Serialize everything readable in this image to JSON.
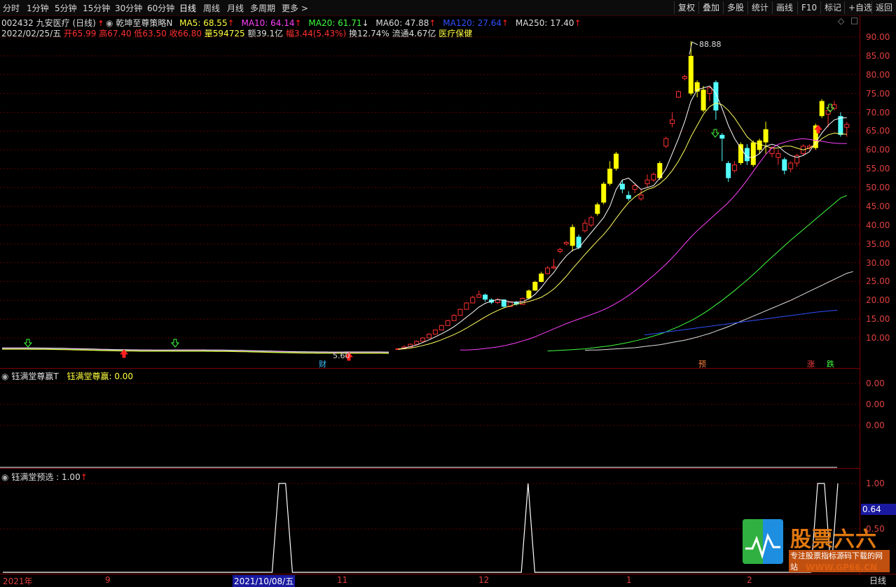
{
  "toolbar": {
    "periods": [
      "分时",
      "1分钟",
      "5分钟",
      "15分钟",
      "30分钟",
      "60分钟",
      "日线",
      "周线",
      "月线",
      "多周期",
      "更多 >"
    ],
    "active_period": "日线",
    "right_buttons": [
      "复权",
      "叠加",
      "多股",
      "统计",
      "画线",
      "F10",
      "标记",
      "+自选",
      "返回"
    ]
  },
  "stock": {
    "code_name": "002432 九安医疗 (日线)",
    "indicator_name": "乾坤至尊策略N",
    "ma5": "MA5: 68.55",
    "ma10": "MA10: 64.14",
    "ma20": "MA20: 61.71",
    "ma60": "MA60: 47.88",
    "ma120": "MA120: 27.64",
    "ma250": "MA250: 17.40",
    "date": "2022/02/25/五",
    "open": "开65.99",
    "high": "高67.40",
    "low": "低63.50",
    "close": "收66.80",
    "volume": "量594725",
    "amount": "额39.1亿",
    "change": "幅3.44(5.43%)",
    "turnover": "换12.74%",
    "float_cap": "流通4.67亿",
    "sector": "医疗保健",
    "colors": {
      "ma5": "#ffffff",
      "ma10": "#ff40ff",
      "ma20": "#00ff00",
      "ma60": "#ffffff",
      "ma120": "#4060ff",
      "ma250": "#ffffff"
    }
  },
  "main_axis": [
    "90.00",
    "85.00",
    "80.00",
    "75.00",
    "70.00",
    "65.00",
    "60.00",
    "55.00",
    "50.00",
    "45.00",
    "40.00",
    "35.00",
    "30.00",
    "25.00",
    "20.00",
    "15.00",
    "10.00"
  ],
  "annotations": {
    "peak": "88.88",
    "low": "5.60",
    "cai": "财",
    "yu": "预",
    "zhang": "涨",
    "die": "跌"
  },
  "panel2": {
    "title": "钰满堂尊赢T",
    "value_label": "钰满堂尊赢: 0.00",
    "axis": [
      "0.00",
      "0.00",
      "0.00"
    ]
  },
  "panel3": {
    "title": "钰满堂预选 : 1.00",
    "axis": [
      "1.00",
      "0.50"
    ],
    "cursor_value": "0.64"
  },
  "xaxis": {
    "labels": [
      "2021年",
      "9",
      "2021/10/08/五",
      "11",
      "12",
      "1",
      "2"
    ],
    "period": "日线"
  },
  "watermark": {
    "brand": "股票六六",
    "slogan": "专注股票指标源码下载的网站",
    "url": "WWW.GP66.CN"
  },
  "chart_data": {
    "type": "candlestick",
    "ylim": [
      5,
      92
    ],
    "candles": [
      {
        "o": 7.0,
        "c": 7.1,
        "h": 7.2,
        "l": 6.9
      },
      {
        "o": 7.2,
        "c": 7.6,
        "h": 8.0,
        "l": 7.1
      },
      {
        "o": 7.6,
        "c": 8.3,
        "h": 8.5,
        "l": 7.5
      },
      {
        "o": 8.3,
        "c": 9.1,
        "h": 9.3,
        "l": 8.2
      },
      {
        "o": 9.1,
        "c": 10.0,
        "h": 10.2,
        "l": 9.0
      },
      {
        "o": 10.0,
        "c": 11.0,
        "h": 11.2,
        "l": 9.9
      },
      {
        "o": 11.0,
        "c": 12.1,
        "h": 12.3,
        "l": 10.9
      },
      {
        "o": 12.1,
        "c": 13.3,
        "h": 13.5,
        "l": 12.0
      },
      {
        "o": 13.3,
        "c": 14.6,
        "h": 14.8,
        "l": 13.2
      },
      {
        "o": 14.6,
        "c": 16.0,
        "h": 16.3,
        "l": 14.5
      },
      {
        "o": 16.0,
        "c": 17.6,
        "h": 17.8,
        "l": 15.9
      },
      {
        "o": 17.6,
        "c": 19.3,
        "h": 19.5,
        "l": 17.5
      },
      {
        "o": 19.3,
        "c": 20.8,
        "h": 21.2,
        "l": 19.2
      },
      {
        "o": 20.8,
        "c": 21.5,
        "h": 22.6,
        "l": 20.6
      },
      {
        "o": 21.5,
        "c": 20.2,
        "h": 21.8,
        "l": 19.6
      },
      {
        "o": 20.2,
        "c": 19.4,
        "h": 20.5,
        "l": 19.0
      },
      {
        "o": 19.4,
        "c": 20.2,
        "h": 20.6,
        "l": 19.0
      },
      {
        "o": 20.2,
        "c": 18.3,
        "h": 20.3,
        "l": 18.1
      },
      {
        "o": 18.3,
        "c": 19.6,
        "h": 19.8,
        "l": 18.2
      },
      {
        "o": 19.6,
        "c": 18.9,
        "h": 19.8,
        "l": 18.6
      },
      {
        "o": 18.9,
        "c": 20.5,
        "h": 20.8,
        "l": 18.8
      },
      {
        "o": 20.5,
        "c": 22.6,
        "h": 22.9,
        "l": 20.4
      },
      {
        "o": 22.6,
        "c": 24.9,
        "h": 25.2,
        "l": 22.5
      },
      {
        "o": 24.9,
        "c": 27.1,
        "h": 27.6,
        "l": 24.8
      },
      {
        "o": 27.1,
        "c": 28.6,
        "h": 29.1,
        "l": 26.9
      },
      {
        "o": 28.6,
        "c": 28.9,
        "h": 31.0,
        "l": 28.3
      },
      {
        "o": 33.0,
        "c": 33.5,
        "h": 34.0,
        "l": 32.5
      },
      {
        "o": 35.0,
        "c": 35.4,
        "h": 35.8,
        "l": 34.6
      },
      {
        "o": 34.5,
        "c": 39.5,
        "h": 40.2,
        "l": 33.0
      },
      {
        "o": 36.9,
        "c": 34.0,
        "h": 37.5,
        "l": 33.6
      },
      {
        "o": 38.5,
        "c": 40.5,
        "h": 41.5,
        "l": 38.0
      },
      {
        "o": 40.0,
        "c": 42.0,
        "h": 42.5,
        "l": 39.5
      },
      {
        "o": 43.0,
        "c": 45.5,
        "h": 46.0,
        "l": 42.5
      },
      {
        "o": 46.0,
        "c": 51.0,
        "h": 51.5,
        "l": 45.5
      },
      {
        "o": 51.0,
        "c": 55.0,
        "h": 57.0,
        "l": 50.5
      },
      {
        "o": 55.0,
        "c": 59.0,
        "h": 59.5,
        "l": 54.5
      },
      {
        "o": 51.0,
        "c": 49.5,
        "h": 52.0,
        "l": 48.5
      },
      {
        "o": 48.0,
        "c": 47.0,
        "h": 49.0,
        "l": 46.5
      },
      {
        "o": 49.5,
        "c": 50.5,
        "h": 51.0,
        "l": 48.5
      },
      {
        "o": 47.0,
        "c": 48.0,
        "h": 49.5,
        "l": 46.5
      },
      {
        "o": 51.0,
        "c": 52.0,
        "h": 53.5,
        "l": 50.0
      },
      {
        "o": 52.0,
        "c": 53.5,
        "h": 54.0,
        "l": 51.5
      },
      {
        "o": 52.5,
        "c": 56.5,
        "h": 57.0,
        "l": 52.0
      },
      {
        "o": 61.0,
        "c": 63.0,
        "h": 63.5,
        "l": 60.5
      },
      {
        "o": 67.0,
        "c": 68.0,
        "h": 70.0,
        "l": 66.0
      },
      {
        "o": 74.0,
        "c": 75.5,
        "h": 75.8,
        "l": 73.8
      },
      {
        "o": 79.0,
        "c": 79.5,
        "h": 80.0,
        "l": 78.5
      },
      {
        "o": 75.0,
        "c": 85.0,
        "h": 88.88,
        "l": 74.5
      },
      {
        "o": 75.5,
        "c": 78.0,
        "h": 78.5,
        "l": 74.0
      },
      {
        "o": 70.5,
        "c": 76.0,
        "h": 77.0,
        "l": 70.0
      },
      {
        "o": 75.0,
        "c": 76.5,
        "h": 77.0,
        "l": 73.0
      },
      {
        "o": 78.0,
        "c": 70.5,
        "h": 78.5,
        "l": 68.0
      },
      {
        "o": 64.0,
        "c": 63.0,
        "h": 64.5,
        "l": 57.0
      },
      {
        "o": 56.5,
        "c": 52.5,
        "h": 57.0,
        "l": 51.5
      },
      {
        "o": 54.5,
        "c": 56.0,
        "h": 57.0,
        "l": 54.0
      },
      {
        "o": 56.5,
        "c": 61.5,
        "h": 62.0,
        "l": 56.0
      },
      {
        "o": 60.5,
        "c": 57.0,
        "h": 61.5,
        "l": 56.0
      },
      {
        "o": 56.0,
        "c": 62.0,
        "h": 62.5,
        "l": 55.5
      },
      {
        "o": 60.0,
        "c": 62.5,
        "h": 63.0,
        "l": 59.0
      },
      {
        "o": 62.0,
        "c": 65.5,
        "h": 67.5,
        "l": 59.0
      },
      {
        "o": 59.0,
        "c": 60.5,
        "h": 61.0,
        "l": 58.0
      },
      {
        "o": 58.0,
        "c": 59.0,
        "h": 60.0,
        "l": 56.0
      },
      {
        "o": 57.5,
        "c": 54.5,
        "h": 58.0,
        "l": 53.5
      },
      {
        "o": 55.0,
        "c": 56.5,
        "h": 57.0,
        "l": 54.0
      },
      {
        "o": 56.5,
        "c": 58.5,
        "h": 59.0,
        "l": 55.5
      },
      {
        "o": 59.0,
        "c": 61.0,
        "h": 61.5,
        "l": 58.5
      },
      {
        "o": 60.5,
        "c": 61.0,
        "h": 61.5,
        "l": 60.0
      },
      {
        "o": 60.5,
        "c": 66.5,
        "h": 67.0,
        "l": 60.0
      },
      {
        "o": 69.0,
        "c": 73.0,
        "h": 73.5,
        "l": 68.5
      },
      {
        "o": 69.5,
        "c": 70.5,
        "h": 72.0,
        "l": 66.0
      },
      {
        "o": 71.0,
        "c": 72.0,
        "h": 73.0,
        "l": 70.5
      },
      {
        "o": 69.0,
        "c": 64.0,
        "h": 70.0,
        "l": 63.5
      },
      {
        "o": 65.99,
        "c": 66.8,
        "h": 67.4,
        "l": 63.5
      }
    ],
    "ma5": [
      7.0,
      7.3,
      7.7,
      8.1,
      8.8,
      9.5,
      10.3,
      11.1,
      12.0,
      13.0,
      14.2,
      15.5,
      16.8,
      18.2,
      19.2,
      19.8,
      20.2,
      20.0,
      19.5,
      19.5,
      19.6,
      20.4,
      21.6,
      23.4,
      25.6,
      27.4,
      29.8,
      31.8,
      33.3,
      33.9,
      36.0,
      38.0,
      40.0,
      42.0,
      45.0,
      49.5,
      52.0,
      52.5,
      51.0,
      49.5,
      50.0,
      50.5,
      52.5,
      55.0,
      59.0,
      63.0,
      67.5,
      73.0,
      76.0,
      76.5,
      77.0,
      75.0,
      71.0,
      66.5,
      63.0,
      60.5,
      58.0,
      58.0,
      59.0,
      61.0,
      61.5,
      61.0,
      59.5,
      58.5,
      58.0,
      58.5,
      59.5,
      62.0,
      64.5,
      66.5,
      68.0,
      68.5,
      68.55
    ],
    "ma10": [
      7.0,
      7.1,
      7.3,
      7.6,
      8.0,
      8.4,
      8.9,
      9.5,
      10.2,
      10.9,
      11.7,
      12.6,
      13.6,
      14.6,
      15.6,
      16.5,
      17.3,
      18.0,
      18.5,
      19.0,
      19.3,
      19.7,
      20.2,
      20.8,
      21.8,
      23.0,
      24.6,
      26.4,
      28.4,
      30.3,
      32.2,
      34.0,
      35.8,
      37.5,
      39.5,
      41.8,
      44.0,
      46.0,
      47.5,
      48.6,
      49.5,
      50.0,
      51.0,
      52.5,
      54.5,
      57.0,
      60.0,
      63.5,
      66.5,
      69.5,
      71.5,
      72.5,
      72.0,
      70.5,
      68.5,
      66.0,
      63.5,
      62.0,
      61.5,
      61.0,
      60.5,
      60.5,
      61.0,
      61.0,
      60.5,
      60.0,
      60.5,
      61.5,
      63.0,
      64.0,
      64.5,
      64.3,
      64.14
    ],
    "ma20": [
      6.8,
      6.8,
      6.9,
      7.0,
      7.2,
      7.4,
      7.6,
      7.9,
      8.3,
      8.7,
      9.2,
      9.7,
      10.3,
      11.0,
      11.7,
      12.4,
      13.1,
      13.8,
      14.4,
      15.0,
      15.6,
      16.2,
      16.8,
      17.5,
      18.3,
      19.2,
      20.2,
      21.3,
      22.5,
      23.8,
      25.2,
      26.6,
      28.1,
      29.6,
      31.3,
      33.1,
      35.0,
      36.8,
      38.5,
      40.0,
      41.5,
      43.0,
      44.5,
      46.0,
      47.8,
      49.8,
      52.0,
      54.3,
      56.6,
      58.8,
      60.5,
      61.5,
      62.0,
      62.5,
      62.8,
      63.0,
      62.8,
      62.5,
      62.3,
      62.0,
      61.8,
      61.7,
      61.71
    ],
    "ma60": [
      6.5,
      6.6,
      6.7,
      6.8,
      6.9,
      7.0,
      7.1,
      7.3,
      7.5,
      7.7,
      7.9,
      8.2,
      8.5,
      8.8,
      9.2,
      9.6,
      10.0,
      10.5,
      11.0,
      11.6,
      12.3,
      13.0,
      13.8,
      14.6,
      15.5,
      16.5,
      17.6,
      18.8,
      20.0,
      21.3,
      22.6,
      24.0,
      25.4,
      26.9,
      28.4,
      30.0,
      31.5,
      33.0,
      34.5,
      36.0,
      37.4,
      38.8,
      40.2,
      41.6,
      43.0,
      44.4,
      45.8,
      47.2,
      47.88
    ],
    "ma120": [
      6.7,
      6.8,
      6.8,
      6.9,
      7.0,
      7.1,
      7.2,
      7.3,
      7.4,
      7.6,
      7.8,
      8.0,
      8.2,
      8.5,
      8.8,
      9.1,
      9.4,
      9.8,
      10.2,
      10.7,
      11.2,
      11.8,
      12.4,
      13.0,
      13.7,
      14.4,
      15.1,
      15.8,
      16.5,
      17.2,
      17.9,
      18.6,
      19.3,
      20.0,
      20.8,
      21.6,
      22.4,
      23.2,
      24.0,
      24.8,
      25.6,
      26.4,
      27.2,
      27.64
    ],
    "ma250": [
      10.8,
      11.2,
      11.6,
      12.0,
      12.4,
      12.8,
      13.2,
      13.6,
      14.0,
      14.4,
      14.8,
      15.2,
      15.6,
      16.0,
      16.4,
      16.8,
      17.1,
      17.4
    ],
    "panel3_signal": [
      0,
      0,
      0,
      0,
      0,
      0,
      0,
      0,
      0,
      0,
      0,
      0,
      0,
      0,
      0,
      0,
      0,
      0,
      0,
      0,
      0,
      0,
      0,
      0,
      0,
      0,
      0,
      0,
      0,
      0,
      0,
      0,
      0,
      0,
      0,
      0,
      0,
      0,
      0,
      0,
      0,
      1,
      1,
      0,
      0,
      0,
      0,
      0,
      0,
      0,
      0,
      0,
      0,
      0,
      0,
      0,
      0,
      0,
      0,
      0,
      0,
      0,
      0,
      0,
      0,
      0,
      0,
      0,
      0,
      0,
      0,
      0,
      0,
      0,
      0,
      0,
      0,
      0,
      1,
      0,
      0,
      0,
      0,
      0,
      0,
      0,
      0,
      0,
      0,
      0,
      0,
      0,
      0,
      0,
      0,
      0,
      0,
      0,
      0,
      0,
      0,
      0,
      0,
      0,
      0,
      0,
      0,
      0,
      0,
      0,
      0,
      0,
      0,
      0,
      0,
      0,
      0,
      0,
      0,
      0,
      0,
      1,
      1,
      0,
      1
    ]
  }
}
